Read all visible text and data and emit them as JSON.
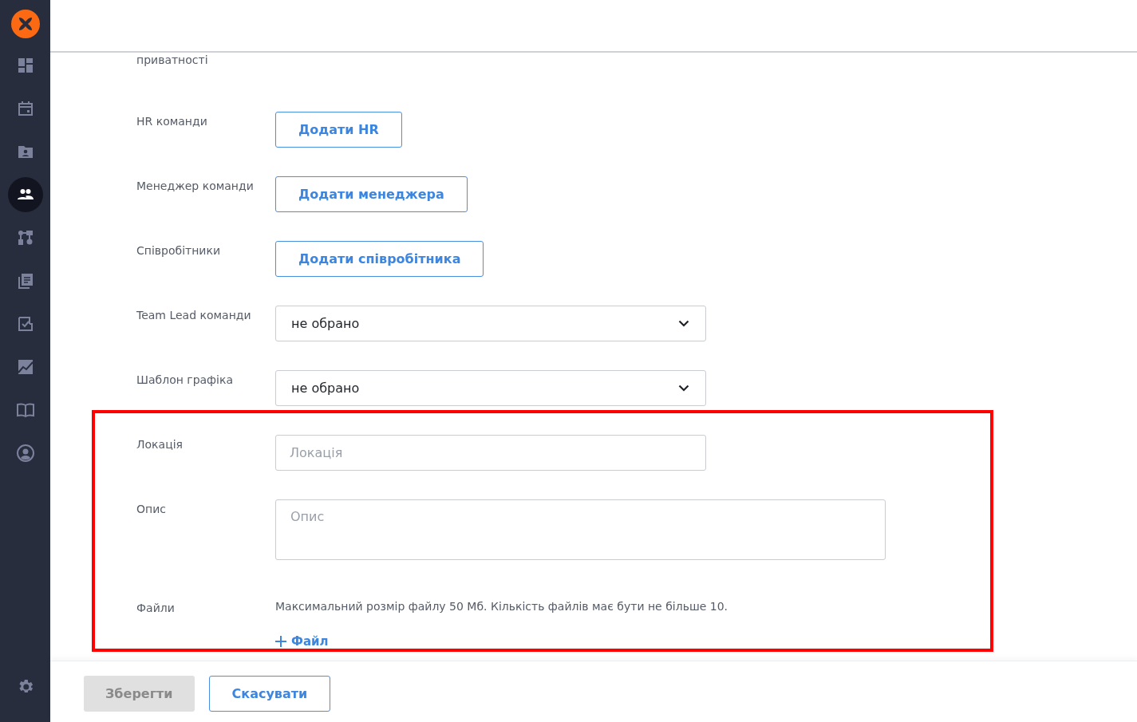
{
  "sidebar": {
    "items": [
      {
        "selected": false
      },
      {
        "selected": false
      },
      {
        "selected": false
      },
      {
        "selected": true
      },
      {
        "selected": false
      },
      {
        "selected": false
      },
      {
        "selected": false
      },
      {
        "selected": false
      },
      {
        "selected": false
      },
      {
        "selected": false
      }
    ]
  },
  "form": {
    "cut_label": "приватності",
    "rows": [
      {
        "kind": "button",
        "label": "HR команди",
        "button": "Додати HR"
      },
      {
        "kind": "button",
        "label": "Менеджер команди",
        "button": "Додати менеджера"
      },
      {
        "kind": "button",
        "label": "Співробітники",
        "button": "Додати співробітника"
      },
      {
        "kind": "select",
        "label": "Team Lead команди",
        "value": "не обрано"
      },
      {
        "kind": "select",
        "label": "Шаблон графіка",
        "value": "не обрано"
      },
      {
        "kind": "input",
        "label": "Локація",
        "placeholder": "Локація"
      },
      {
        "kind": "textarea",
        "label": "Опис",
        "placeholder": "Опис"
      },
      {
        "kind": "files",
        "label": "Файли",
        "hint": "Максимальний розмір файлу 50 Мб. Кількість файлів має бути не більше 10.",
        "button": "Файл"
      }
    ]
  },
  "footer": {
    "buttons": [
      {
        "label": "Зберегти",
        "disabled": true
      },
      {
        "label": "Скасувати",
        "disabled": false
      }
    ]
  }
}
